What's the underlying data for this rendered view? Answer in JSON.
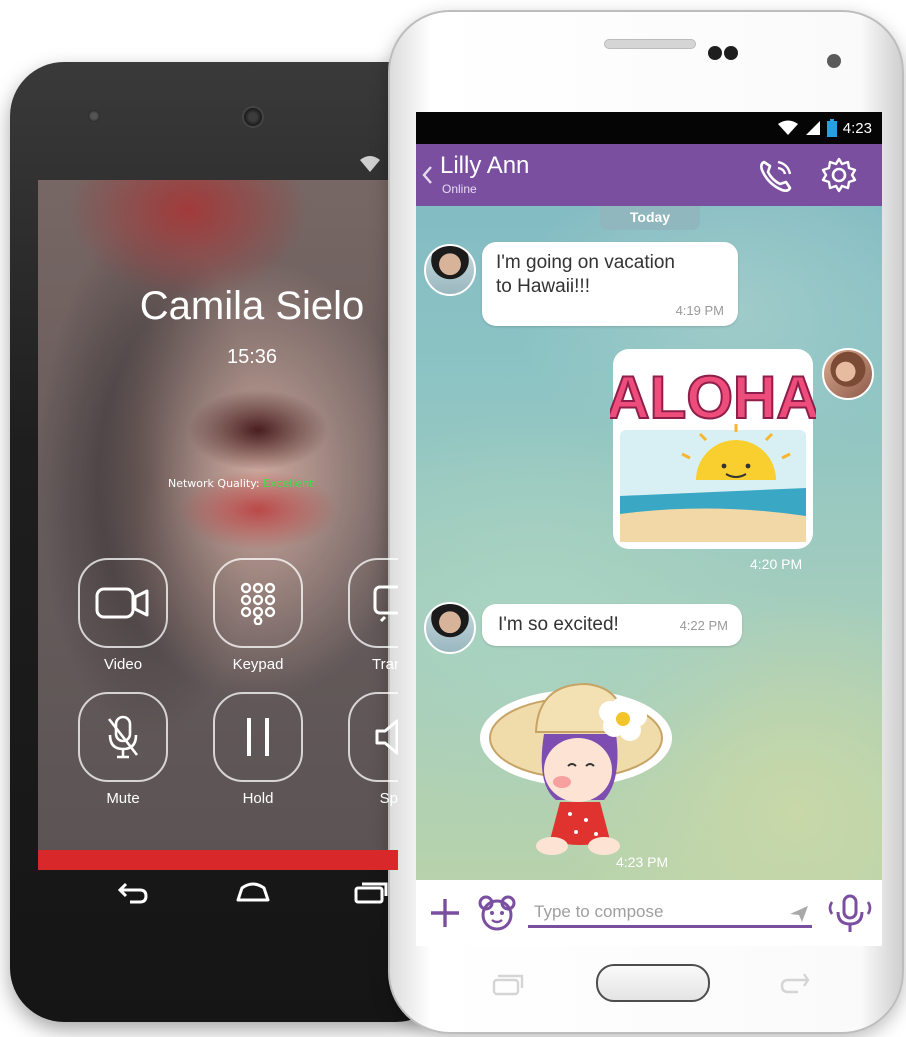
{
  "back_phone": {
    "caller_name": "Camila Sielo",
    "call_duration": "15:36",
    "network_quality_label": "Network Quality:",
    "network_quality_value": "Excellent",
    "buttons": {
      "video": "Video",
      "keypad": "Keypad",
      "transfer": "Transf",
      "mute": "Mute",
      "hold": "Hold",
      "speaker": "Spe"
    },
    "colors": {
      "end_call": "#d8282a",
      "quality_good": "#3be04a"
    }
  },
  "front_phone": {
    "status_bar": {
      "time": "4:23"
    },
    "header": {
      "contact_name": "Lilly Ann",
      "contact_status": "Online"
    },
    "date_chip": "Today",
    "messages": [
      {
        "line1": "I'm going on vacation",
        "line2": "to Hawaii!!!",
        "time": "4:19 PM"
      },
      {
        "sticker": "ALOHA",
        "time": "4:20 PM"
      },
      {
        "line1": "I'm so excited!",
        "time": "4:22 PM"
      },
      {
        "sticker": "girl-in-sunhat",
        "time": "4:23 PM"
      }
    ],
    "compose": {
      "placeholder": "Type to compose"
    },
    "colors": {
      "brand": "#7b4fa0"
    }
  },
  "icons": [
    "wifi-icon",
    "signal-icon",
    "battery-icon",
    "back-chevron-icon",
    "phone-call-icon",
    "settings-gear-icon",
    "video-camera-icon",
    "keypad-icon",
    "transfer-icon",
    "mute-mic-icon",
    "hold-pause-icon",
    "speaker-icon",
    "end-call-icon",
    "nav-back-icon",
    "nav-home-icon",
    "nav-recent-icon",
    "plus-icon",
    "sticker-bear-icon",
    "send-icon",
    "microphone-icon"
  ]
}
